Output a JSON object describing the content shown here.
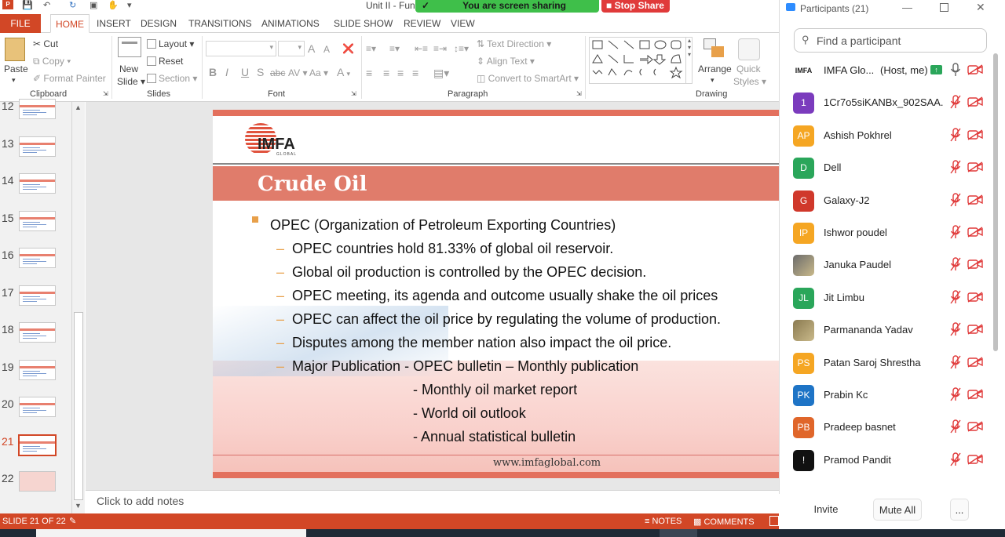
{
  "app": {
    "title": "Unit II - Fun",
    "logo_letter": "P",
    "share_banner": "You are screen sharing",
    "stop_share": "Stop Share"
  },
  "tabs": [
    "FILE",
    "HOME",
    "INSERT",
    "DESIGN",
    "TRANSITIONS",
    "ANIMATIONS",
    "SLIDE SHOW",
    "REVIEW",
    "VIEW"
  ],
  "ribbon": {
    "clipboard": {
      "paste": "Paste",
      "cut": "Cut",
      "copy": "Copy",
      "format_painter": "Format Painter",
      "label": "Clipboard"
    },
    "slides": {
      "new_slide_1": "New",
      "new_slide_2": "Slide",
      "layout": "Layout",
      "reset": "Reset",
      "section": "Section",
      "label": "Slides"
    },
    "font": {
      "size_up": "A",
      "size_down": "A",
      "bold": "B",
      "italic": "I",
      "underline": "U",
      "shadow": "S",
      "strike": "abc",
      "spacing": "AV",
      "case": "Aa",
      "color": "A",
      "label": "Font"
    },
    "paragraph": {
      "text_direction": "Text Direction",
      "align_text": "Align Text",
      "smartart": "Convert to SmartArt",
      "label": "Paragraph"
    },
    "drawing": {
      "arrange": "Arrange",
      "quick_styles_1": "Quick",
      "quick_styles_2": "Styles",
      "label": "Drawing"
    }
  },
  "thumbnails": [
    "12",
    "13",
    "14",
    "15",
    "16",
    "17",
    "18",
    "19",
    "20",
    "21",
    "22"
  ],
  "slide": {
    "logo": "IMFA",
    "logo_sub": "GLOBAL",
    "title": "Crude Oil",
    "bullet": "OPEC (Organization of Petroleum Exporting Countries)",
    "dash": "–",
    "subs": [
      "OPEC countries hold 81.33% of global oil reservoir.",
      "Global oil production is controlled by the OPEC decision.",
      "OPEC meeting, its agenda and outcome usually shake the oil prices",
      "OPEC can affect the oil price by regulating the volume of production.",
      "Disputes among the member nation also impact the oil price.",
      "Major Publication - OPEC bulletin – Monthly publication"
    ],
    "pubs": [
      "- Monthly oil market report",
      "- World oil outlook",
      "- Annual statistical bulletin"
    ],
    "url": "www.imfaglobal.com"
  },
  "notes_placeholder": "Click to add notes",
  "status": {
    "slide_info": "SLIDE 21 OF 22",
    "notes": "NOTES",
    "comments": "COMMENTS"
  },
  "participants": {
    "title": "Participants (21)",
    "search_placeholder": "Find a participant",
    "host_tag": "(Host, me)",
    "list": [
      {
        "name": "IMFA Glo...",
        "initials": "IMFA",
        "color": "#ffffff"
      },
      {
        "name": "1Cr7o5siKANBx_902SAA...",
        "initials": "1",
        "color": "#7b3bbd"
      },
      {
        "name": "Ashish Pokhrel",
        "initials": "AP",
        "color": "#f5a623"
      },
      {
        "name": "Dell",
        "initials": "D",
        "color": "#2aa65a"
      },
      {
        "name": "Galaxy-J2",
        "initials": "G",
        "color": "#d0382b"
      },
      {
        "name": "Ishwor poudel",
        "initials": "IP",
        "color": "#f5a623"
      },
      {
        "name": "Januka Paudel",
        "initials": "",
        "color": "#6b6b6b"
      },
      {
        "name": "Jit Limbu",
        "initials": "JL",
        "color": "#2aa65a"
      },
      {
        "name": "Parmananda Yadav",
        "initials": "",
        "color": "#8a7a50"
      },
      {
        "name": "Patan Saroj Shrestha",
        "initials": "PS",
        "color": "#f5a623"
      },
      {
        "name": "Prabin Kc",
        "initials": "PK",
        "color": "#1e74c6"
      },
      {
        "name": "Pradeep basnet",
        "initials": "PB",
        "color": "#e0662a"
      },
      {
        "name": "Pramod Pandit",
        "initials": "!",
        "color": "#111111"
      }
    ],
    "invite": "Invite",
    "mute_all": "Mute All",
    "more": "..."
  }
}
